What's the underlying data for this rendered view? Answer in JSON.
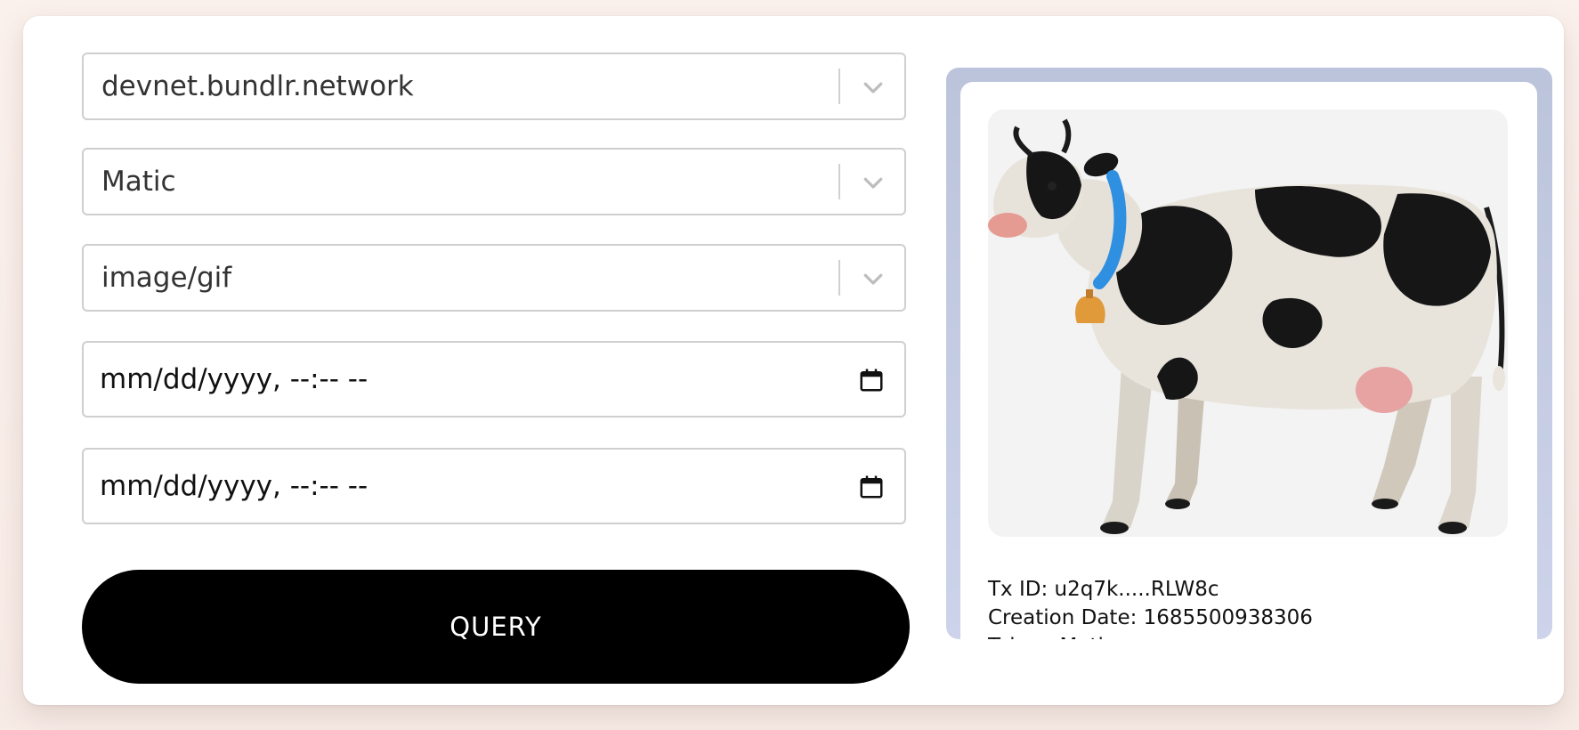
{
  "form": {
    "network_select": {
      "value": "devnet.bundlr.network"
    },
    "currency_select": {
      "value": "Matic"
    },
    "content_type_select": {
      "value": "image/gif"
    },
    "from_date": {
      "value": "mm/dd/yyyy, --:-- --"
    },
    "to_date": {
      "value": "mm/dd/yyyy, --:-- --"
    },
    "query_label": "QUERY"
  },
  "result": {
    "image": {
      "subject": "cow"
    },
    "tx_id": "Tx ID: u2q7k.....RLW8c",
    "creation_date": "Creation Date: 1685500938306",
    "token": "Token: Matic"
  },
  "icons": {
    "chevron": "chevron-down-icon",
    "calendar": "calendar-icon"
  }
}
